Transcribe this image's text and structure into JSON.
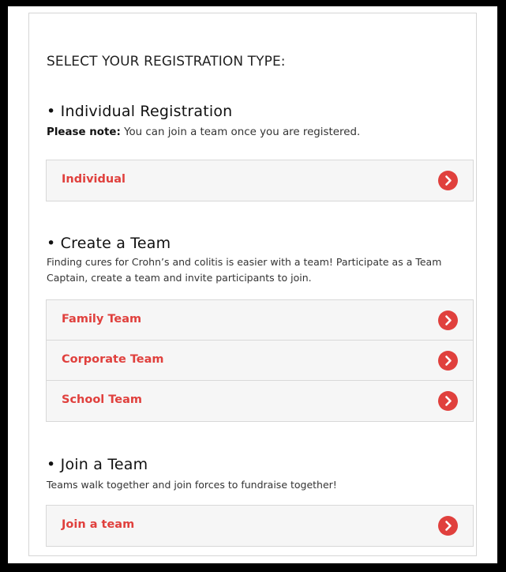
{
  "heading": "SELECT YOUR REGISTRATION TYPE:",
  "sections": [
    {
      "title": "• Individual Registration",
      "note_label": "Please note:",
      "description": " You can join a team once you are registered.",
      "options": [
        {
          "label": "Individual"
        }
      ]
    },
    {
      "title": "• Create a Team",
      "description": "Finding cures for Crohn’s and colitis is easier with a team! Participate as a Team Captain, create a team and invite participants to join.",
      "options": [
        {
          "label": "Family Team"
        },
        {
          "label": "Corporate Team"
        },
        {
          "label": "School Team"
        }
      ]
    },
    {
      "title": "• Join a Team",
      "description": "Teams walk together and join forces to fundraise together!",
      "options": [
        {
          "label": "Join a team"
        }
      ]
    }
  ],
  "colors": {
    "accent": "#e0403d",
    "option_bg": "#f6f6f6",
    "border": "#d8d8d8"
  },
  "icons": {
    "option_arrow": "chevron-right-circle-icon"
  }
}
